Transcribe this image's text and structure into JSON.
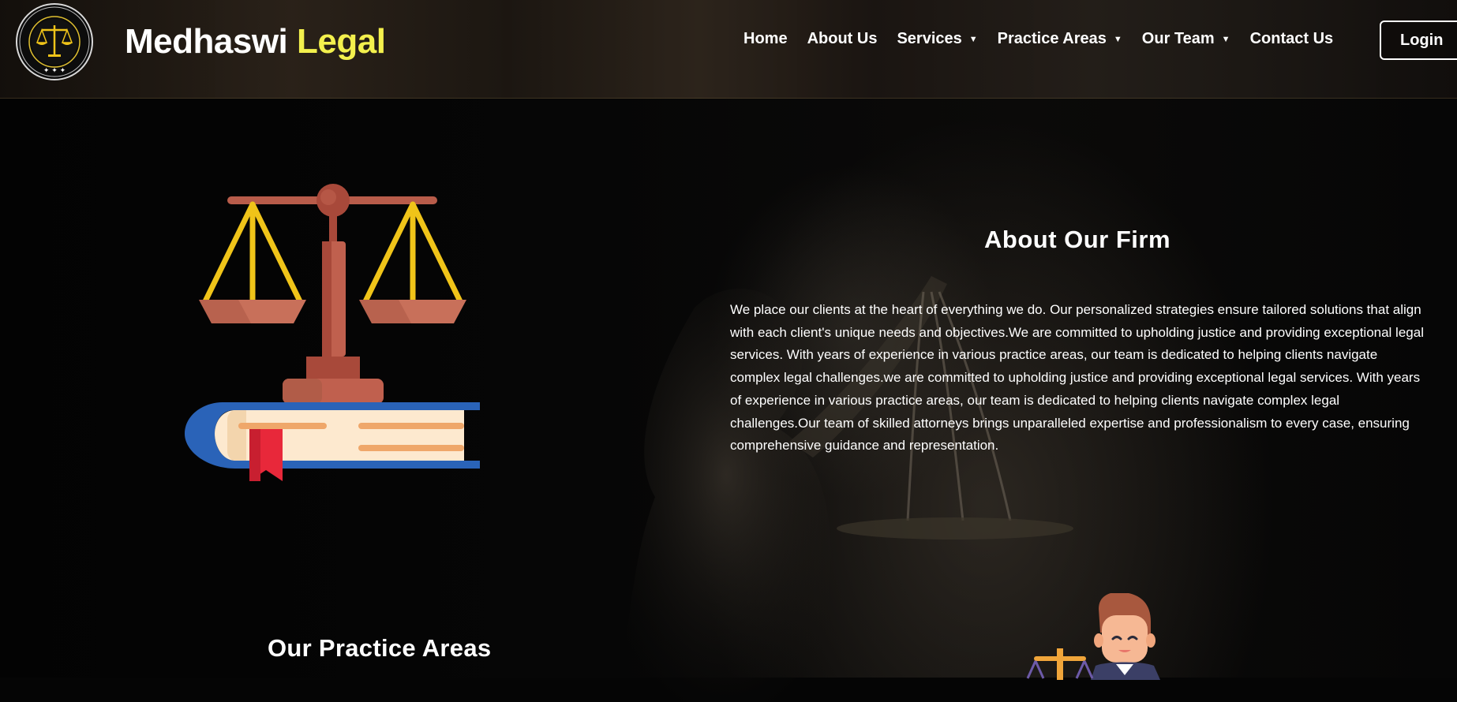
{
  "brand": {
    "name_part1": "Medhaswi",
    "name_part2": "Legal",
    "logo_text": "MEDHASWI ENFORCEMENT & LEGAL SERVICES",
    "logo_motto": "सत्यमेव जयते"
  },
  "nav": {
    "items": [
      {
        "label": "Home",
        "has_dropdown": false
      },
      {
        "label": "About Us",
        "has_dropdown": false
      },
      {
        "label": "Services",
        "has_dropdown": true
      },
      {
        "label": "Practice Areas",
        "has_dropdown": true
      },
      {
        "label": "Our Team",
        "has_dropdown": true
      },
      {
        "label": "Contact Us",
        "has_dropdown": false
      }
    ],
    "login_label": "Login"
  },
  "about": {
    "title": "About Our Firm",
    "body": "We place our clients at the heart of everything we do. Our personalized strategies ensure tailored solutions that align with each client's unique needs and objectives.We are committed to upholding justice and providing exceptional legal services. With years of experience in various practice areas, our team is dedicated to helping clients navigate complex legal challenges.we are committed to upholding justice and providing exceptional legal services. With years of experience in various practice areas, our team is dedicated to helping clients navigate complex legal challenges.Our team of skilled attorneys brings unparalleled expertise and professionalism to every case, ensuring comprehensive guidance and representation."
  },
  "practice": {
    "title": "Our Practice Areas"
  },
  "icons": {
    "scales_on_book": "scales-of-justice-on-book-illustration",
    "lawyer": "lawyer-with-scales-illustration",
    "dropdown": "caret-down-icon"
  },
  "colors": {
    "brand_accent": "#f3f04d",
    "text": "#ffffff",
    "background": "#050505"
  }
}
